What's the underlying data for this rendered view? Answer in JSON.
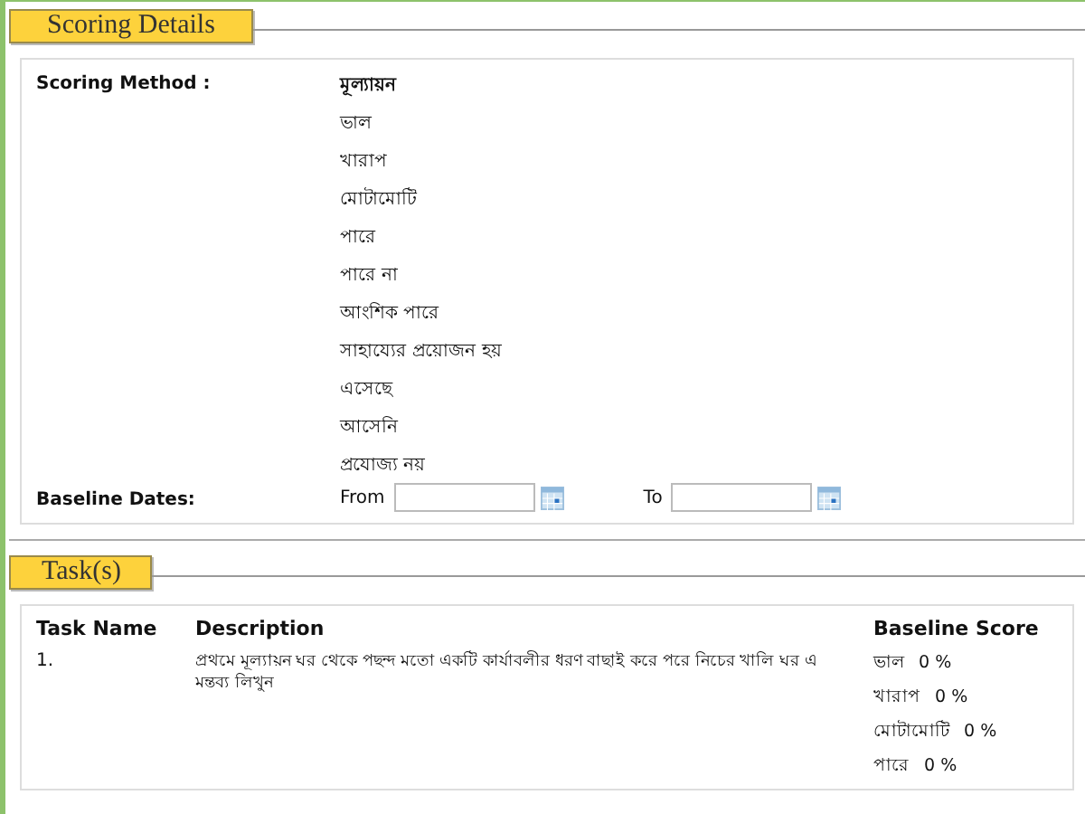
{
  "scoring": {
    "legend": "Scoring Details",
    "method_label": "Scoring Method :",
    "methods": [
      {
        "text": "মূল্যায়ন",
        "kind": "heading"
      },
      {
        "text": "ভাল",
        "kind": "option"
      },
      {
        "text": "খারাপ",
        "kind": "option"
      },
      {
        "text": "মোটামোটি",
        "kind": "option"
      },
      {
        "text": "পারে",
        "kind": "option"
      },
      {
        "text": "পারে না",
        "kind": "option"
      },
      {
        "text": "আংশিক পারে",
        "kind": "option"
      },
      {
        "text": "সাহায্যের প্রয়োজন হয়",
        "kind": "option"
      },
      {
        "text": "এসেছে",
        "kind": "option"
      },
      {
        "text": "আসেনি",
        "kind": "option"
      },
      {
        "text": "প্রযোজ্য নয়",
        "kind": "option"
      }
    ],
    "dates_label": "Baseline Dates:",
    "from_label": "From",
    "to_label": "To"
  },
  "tasks": {
    "legend": "Task(s)",
    "columns": [
      "Task Name",
      "Description",
      "Baseline Score"
    ],
    "rows": [
      {
        "name": "1.",
        "description": "প্রথমে মূল্যায়ন ঘর থেকে পছন্দ মতো একটি কার্যাবলীর ধরণ বাছাই করে পরে নিচের খালি ঘর এ মন্তব্য লিখুন",
        "scores": [
          {
            "label": "ভাল",
            "value": "0 %"
          },
          {
            "label": "খারাপ",
            "value": "0 %"
          },
          {
            "label": "মোটামোটি",
            "value": "0 %"
          },
          {
            "label": "পারে",
            "value": "0 %"
          }
        ]
      }
    ]
  }
}
